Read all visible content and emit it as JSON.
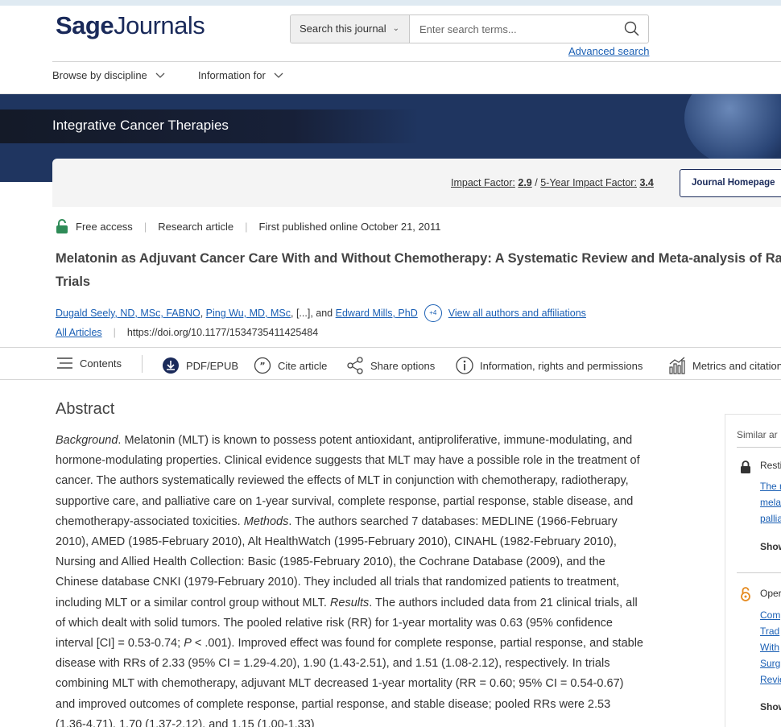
{
  "header": {
    "logo_bold": "Sage",
    "logo_light": "Journals",
    "search_scope": "Search this journal",
    "search_placeholder": "Enter search terms...",
    "advanced_search": "Advanced search"
  },
  "nav": {
    "browse": "Browse by discipline",
    "info_for": "Information for"
  },
  "journal": {
    "title": "Integrative Cancer Therapies",
    "impact_label": "Impact Factor:",
    "impact_value": "2.9",
    "slash": "/",
    "five_year_label": "5-Year Impact Factor:",
    "five_year_value": "3.4",
    "homepage_button": "Journal Homepage"
  },
  "article": {
    "access": "Free access",
    "type": "Research article",
    "published": "First published online October 21, 2011",
    "title_line1": "Melatonin as Adjuvant Cancer Care With and Without Chemotherapy: A Systematic Review and Meta-analysis of Ra",
    "title_line2": "Trials",
    "author1": "Dugald Seely, ND, MSc, FABNO",
    "comma1": ",",
    "author2": "Ping Wu, MD, MSc",
    "ellipsis": ", [...], and",
    "author3": "Edward Mills, PhD",
    "more_authors": "+4",
    "view_all": "View all authors and affiliations",
    "all_articles": "All Articles",
    "doi": "https://doi.org/10.1177/1534735411425484"
  },
  "toolbar": {
    "contents": "Contents",
    "pdf": "PDF/EPUB",
    "cite": "Cite article",
    "share": "Share options",
    "info": "Information, rights and permissions",
    "metrics": "Metrics and citations"
  },
  "abstract": {
    "heading": "Abstract",
    "bg_label": "Background",
    "bg_text": ". Melatonin (MLT) is known to possess potent antioxidant, antiproliferative, immune-modulating, and hormone-modulating properties. Clinical evidence suggests that MLT may have a possible role in the treatment of cancer. The authors systematically reviewed the effects of MLT in conjunction with chemotherapy, radiotherapy, supportive care, and palliative care on 1-year survival, complete response, partial response, stable disease, and chemotherapy-associated toxicities. ",
    "methods_label": "Methods",
    "methods_text": ". The authors searched 7 databases: MEDLINE (1966-February 2010), AMED (1985-February 2010), Alt HealthWatch (1995-February 2010), CINAHL (1982-February 2010), Nursing and Allied Health Collection: Basic (1985-February 2010), the Cochrane Database (2009), and the Chinese database CNKI (1979-February 2010). They included all trials that randomized patients to treatment, including MLT or a similar control group without MLT. ",
    "results_label": "Results",
    "results_text1": ". The authors included data from 21 clinical trials, all of which dealt with solid tumors. The pooled relative risk (RR) for 1-year mortality was 0.63 (95% confidence interval [CI] = 0.53-0.74; ",
    "p_label": "P",
    "results_text2": " < .001). Improved effect was found for complete response, partial response, and stable disease with RRs of 2.33 (95% CI = 1.29-4.20), 1.90 (1.43-2.51), and 1.51 (1.08-2.12), respectively. In trials combining MLT with chemotherapy, adjuvant MLT decreased 1-year mortality (RR = 0.60; 95% CI = 0.54-0.67) and improved outcomes of complete response, partial response, and stable disease; pooled RRs were 2.53 (1.36-4.71), 1.70 (1.37-2.12), and 1.15 (1.00-1.33)"
  },
  "sidebar": {
    "heading": "Similar ar",
    "item1_tag": "Resti",
    "item1_link1": "The r",
    "item1_link2": "melat",
    "item1_link3": "pallia",
    "item1_show": "Show",
    "item2_tag": "Oper",
    "item2_link1": "Comp",
    "item2_link2": "Trad",
    "item2_link3": "With",
    "item2_link4": "Surg",
    "item2_link5": "Revie",
    "item2_show": "Show"
  },
  "colors": {
    "brand_navy": "#1a2a5a",
    "banner": "#1f3560",
    "link": "#1a5fb4",
    "lock_green": "#2e8b57",
    "open_orange": "#e58a1f"
  }
}
